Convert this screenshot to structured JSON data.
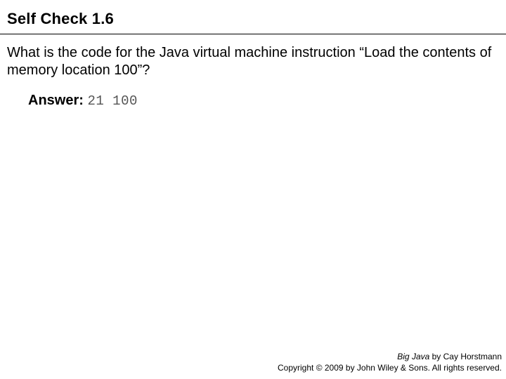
{
  "title": "Self Check 1.6",
  "question": "What is the code for the Java virtual machine instruction “Load the contents of memory location 100”?",
  "answer_label": "Answer:",
  "answer_code": "21 100",
  "footer": {
    "book_title": "Big Java",
    "byline": " by Cay Horstmann",
    "copyright": "Copyright © 2009 by John Wiley & Sons. All rights reserved."
  }
}
